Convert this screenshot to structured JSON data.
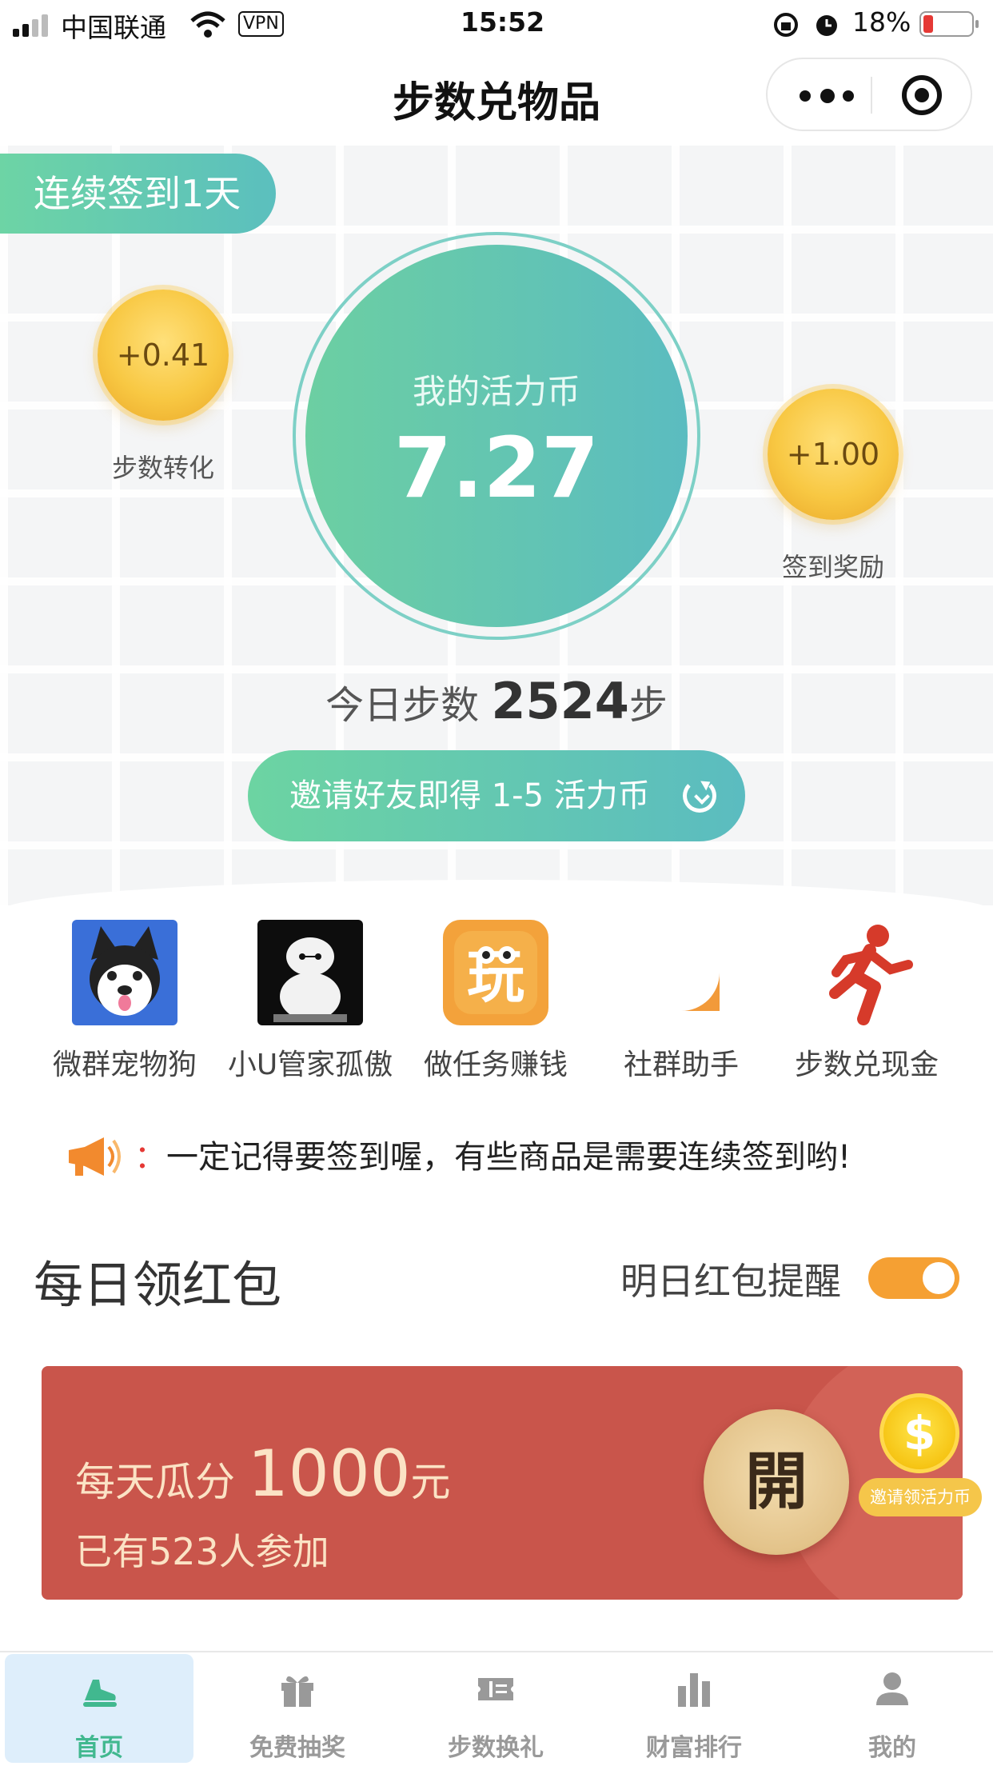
{
  "status_bar": {
    "carrier": "中国联通",
    "vpn": "VPN",
    "time": "15:52",
    "battery": "18%"
  },
  "nav": {
    "title": "步数兑物品"
  },
  "hero": {
    "streak_label": "连续签到1天",
    "left_bubble": {
      "value": "+0.41",
      "label": "步数转化"
    },
    "right_bubble": {
      "value": "+1.00",
      "label": "签到奖励"
    },
    "balance_label": "我的活力币",
    "balance_value": "7.27",
    "steps_prefix": "今日步数",
    "steps_value": "2524",
    "steps_unit": "步",
    "invite_label": "邀请好友即得 1-5 活力币"
  },
  "apps": [
    {
      "label": "微群宠物狗",
      "icon": "husky-dog-icon"
    },
    {
      "label": "小U管家孤傲",
      "icon": "white-robot-icon"
    },
    {
      "label": "做任务赚钱",
      "icon": "play-cat-icon"
    },
    {
      "label": "社群助手",
      "icon": "chat-bubble-icon"
    },
    {
      "label": "步数兑现金",
      "icon": "running-man-icon"
    }
  ],
  "notice": {
    "colon": "：",
    "text": "一定记得要签到喔，有些商品是需要连续签到哟!"
  },
  "red_packet": {
    "section_title": "每日领红包",
    "remind_label": "明日红包提醒",
    "remind_enabled": true,
    "title_prefix": "每天瓜分 ",
    "title_amount": "1000",
    "title_unit": "元",
    "participants": "已有523人参加",
    "open_label": "開",
    "coin_symbol": "$",
    "coin_tag": "邀请领活力币"
  },
  "tabbar": [
    {
      "label": "首页",
      "icon": "shoe-icon",
      "active": true
    },
    {
      "label": "免费抽奖",
      "icon": "gift-icon",
      "active": false
    },
    {
      "label": "步数换礼",
      "icon": "ticket-icon",
      "active": false
    },
    {
      "label": "财富排行",
      "icon": "bar-chart-icon",
      "active": false
    },
    {
      "label": "我的",
      "icon": "person-icon",
      "active": false
    }
  ],
  "colors": {
    "accent_green": "#5bbfbe",
    "packet_red": "#c9554b",
    "toggle_orange": "#f5a033",
    "tab_active": "#41b88f"
  }
}
